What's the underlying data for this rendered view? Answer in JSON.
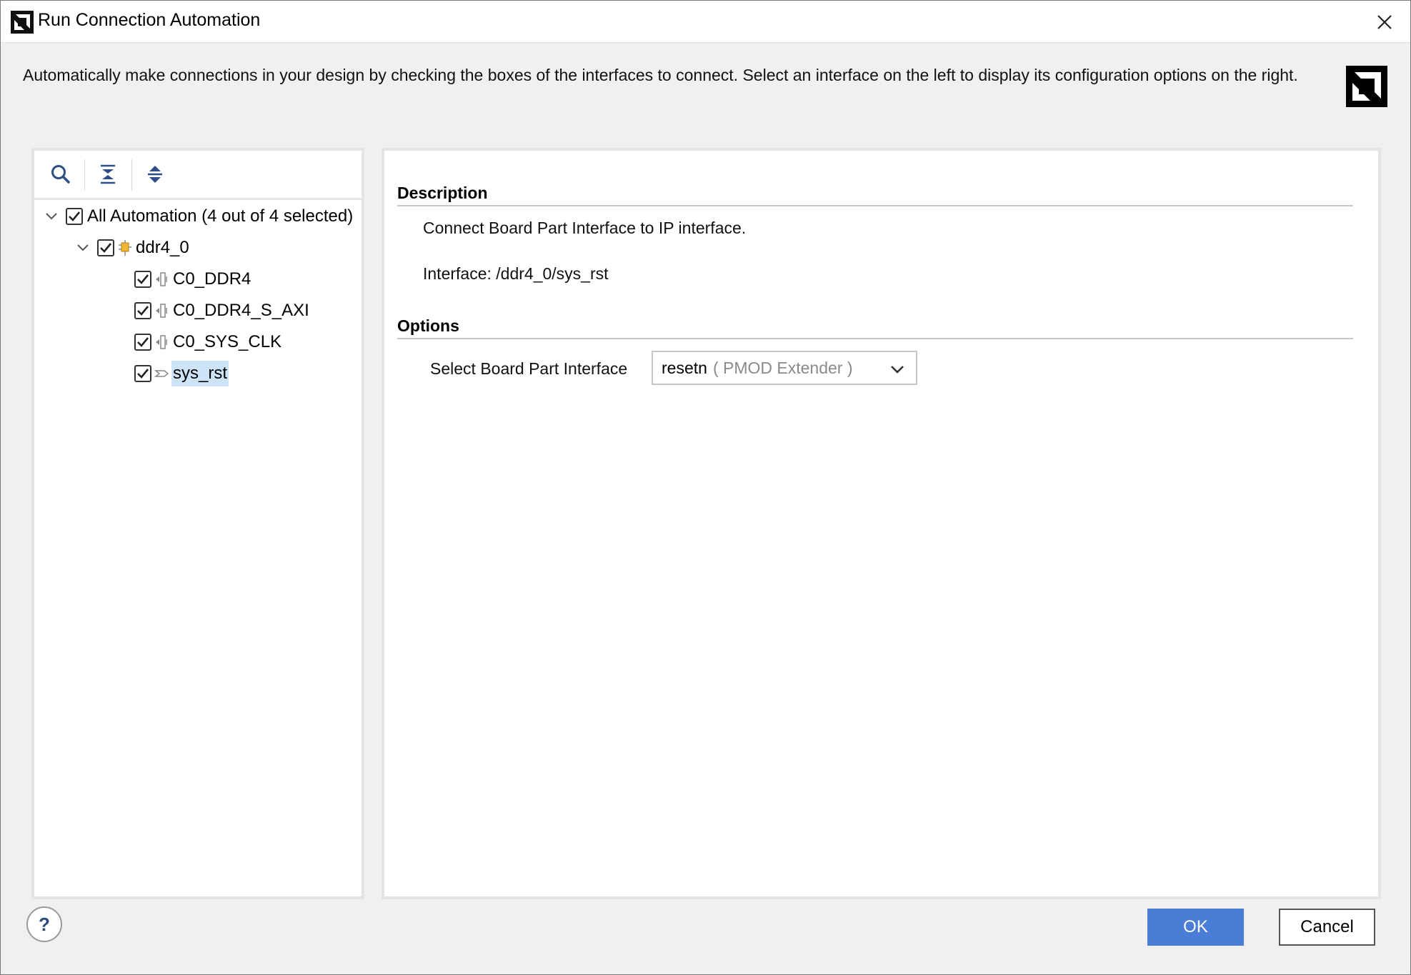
{
  "window": {
    "title": "Run Connection Automation",
    "intro": "Automatically make connections in your design by checking the boxes of the interfaces to connect. Select an interface on the left to display its configuration options on the right."
  },
  "toolbar": {
    "icons": [
      "search-icon",
      "collapse-all-icon",
      "expand-all-icon"
    ]
  },
  "tree": {
    "root": {
      "label": "All Automation (4 out of 4 selected)",
      "checked": true,
      "expanded": true
    },
    "ip": {
      "label": "ddr4_0",
      "checked": true,
      "expanded": true
    },
    "items": [
      {
        "label": "C0_DDR4",
        "checked": true,
        "icon": "bus-interface-icon"
      },
      {
        "label": "C0_DDR4_S_AXI",
        "checked": true,
        "icon": "bus-interface-icon"
      },
      {
        "label": "C0_SYS_CLK",
        "checked": true,
        "icon": "bus-interface-icon"
      },
      {
        "label": "sys_rst",
        "checked": true,
        "icon": "reset-port-icon",
        "selected": true
      }
    ]
  },
  "details": {
    "description_title": "Description",
    "description_text": "Connect Board Part Interface to IP interface.",
    "interface_text": "Interface: /ddr4_0/sys_rst",
    "options_title": "Options",
    "board_part_label": "Select Board Part Interface",
    "board_part_value": "resetn",
    "board_part_sub": "( PMOD Extender )"
  },
  "buttons": {
    "help": "?",
    "ok": "OK",
    "cancel": "Cancel"
  },
  "colors": {
    "ok_button": "#4a7dd6",
    "selection": "#cde3f7",
    "toolbar_icon": "#2d4f85"
  }
}
